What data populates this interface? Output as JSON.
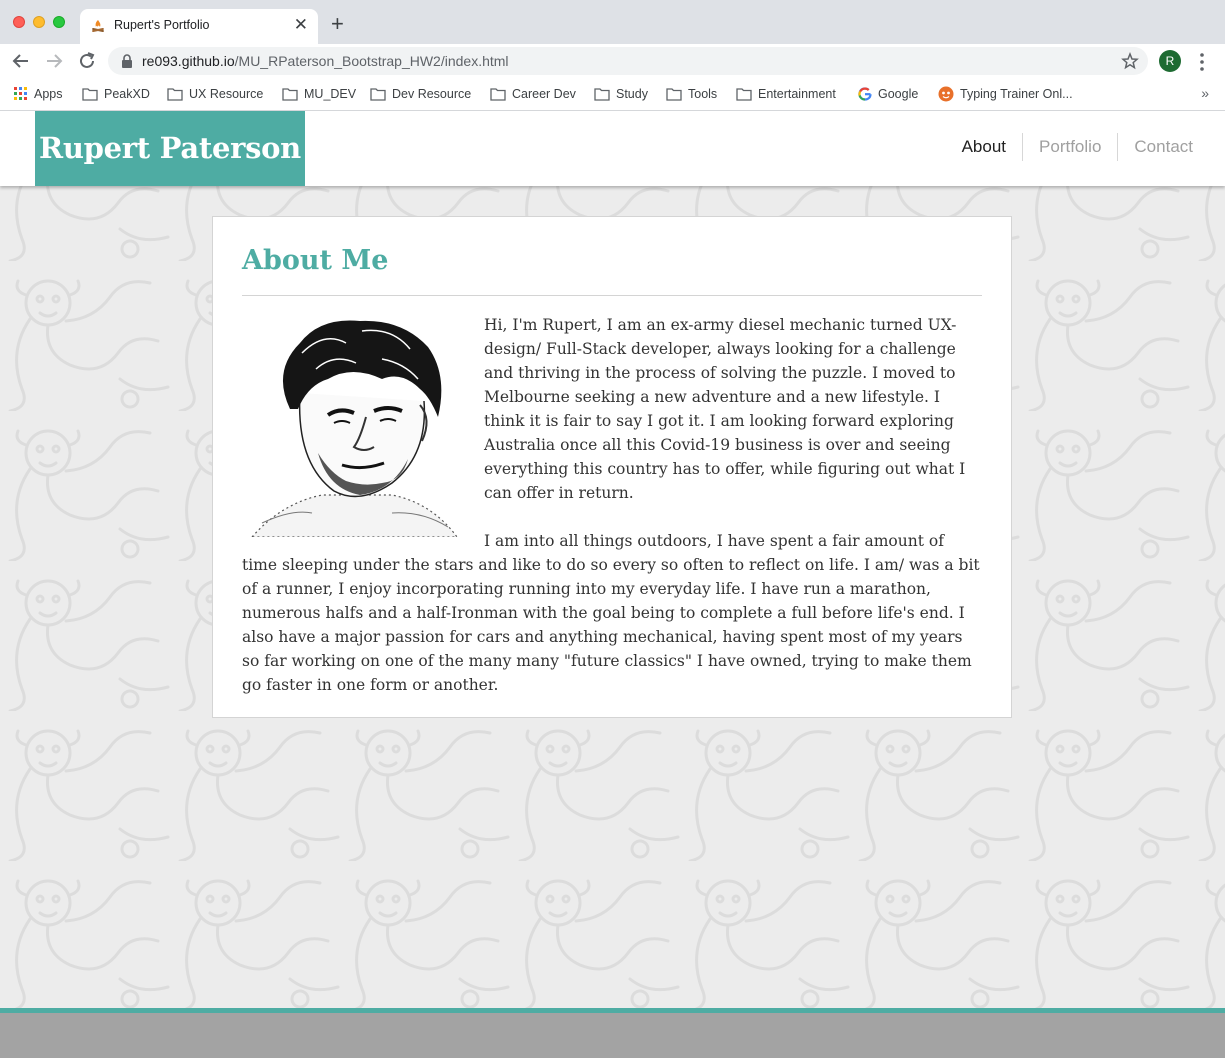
{
  "browser": {
    "tab_title": "Rupert's Portfolio",
    "new_tab_symbol": "+",
    "close_symbol": "✕",
    "url_host": "re093.github.io",
    "url_path": "/MU_RPaterson_Bootstrap_HW2/index.html",
    "profile_initial": "R",
    "bookmarks_more": "»",
    "bookmarks": [
      {
        "label": "Apps",
        "icon": "apps-grid-icon"
      },
      {
        "label": "PeakXD",
        "icon": "folder-icon"
      },
      {
        "label": "UX Resource",
        "icon": "folder-icon"
      },
      {
        "label": "MU_DEV",
        "icon": "folder-icon"
      },
      {
        "label": "Dev Resource",
        "icon": "folder-icon"
      },
      {
        "label": "Career Dev",
        "icon": "folder-icon"
      },
      {
        "label": "Study",
        "icon": "folder-icon"
      },
      {
        "label": "Tools",
        "icon": "folder-icon"
      },
      {
        "label": "Entertainment",
        "icon": "folder-icon"
      },
      {
        "label": "Google",
        "icon": "google-icon"
      },
      {
        "label": "Typing Trainer Onl...",
        "icon": "typing-trainer-icon"
      }
    ]
  },
  "site": {
    "brand": "Rupert Paterson",
    "nav": [
      "About",
      "Portfolio",
      "Contact"
    ],
    "accent_color": "#4eaca3",
    "about": {
      "heading": "About Me",
      "paragraphs": [
        "Hi, I'm Rupert, I am an ex-army diesel mechanic turned UX-design/ Full-Stack developer, always looking for a challenge and thriving in the process of solving the puzzle. I moved to Melbourne seeking a new adventure and a new lifestyle. I think it is fair to say I got it. I am looking forward exploring Australia once all this Covid-19 business is over and seeing everything this country has to offer, while figuring out what I can offer in return.",
        "I am into all things outdoors, I have spent a fair amount of time sleeping under the stars and like to do so every so often to reflect on life. I am/ was a bit of a runner, I enjoy incorporating running into my everyday life. I have run a marathon, numerous halfs and a half-Ironman with the goal being to complete a full before life's end. I also have a major passion for cars and anything mechanical, having spent most of my years so far working on one of the many many \"future classics\" I have owned, trying to make them go faster in one form or another."
      ]
    }
  }
}
